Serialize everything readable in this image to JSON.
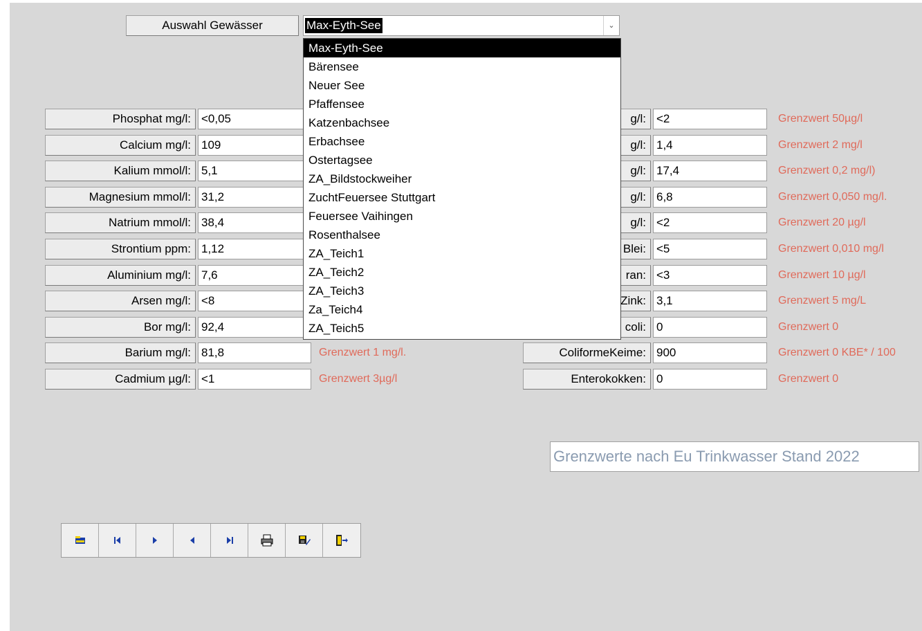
{
  "selector": {
    "label": "Auswahl Gewässer",
    "value": "Max-Eyth-See",
    "options": [
      "Max-Eyth-See",
      "Bärensee",
      "Neuer See",
      "Pfaffensee",
      "Katzenbachsee",
      "Erbachsee",
      "Ostertagsee",
      "ZA_Bildstockweiher",
      "ZuchtFeuersee Stuttgart",
      "Feuersee Vaihingen",
      "Rosenthalsee",
      "ZA_Teich1",
      "ZA_Teich2",
      "ZA_Teich3",
      "Za_Teich4",
      "ZA_Teich5"
    ]
  },
  "left": [
    {
      "label": "Phosphat mg/l:",
      "value": "<0,05"
    },
    {
      "label": "Calcium mg/l:",
      "value": "109"
    },
    {
      "label": "Kalium mmol/l:",
      "value": "5,1"
    },
    {
      "label": "Magnesium mmol/l:",
      "value": "31,2"
    },
    {
      "label": "Natrium mmol/l:",
      "value": "38,4"
    },
    {
      "label": "Strontium ppm:",
      "value": "1,12"
    },
    {
      "label": "Aluminium mg/l:",
      "value": "7,6"
    },
    {
      "label": "Arsen mg/l:",
      "value": "<8"
    },
    {
      "label": "Bor mg/l:",
      "value": "92,4"
    },
    {
      "label": "Barium mg/l:",
      "value": "81,8",
      "limit": "Grenzwert 1 mg/l."
    },
    {
      "label": "Cadmium µg/l:",
      "value": "<1",
      "limit": "Grenzwert 3µg/l"
    }
  ],
  "right": [
    {
      "label": "g/l:",
      "value": "<2",
      "limit": "Grenzwert 50µg/l"
    },
    {
      "label": "g/l:",
      "value": "1,4",
      "limit": "Grenzwert 2 mg/l"
    },
    {
      "label": "g/l:",
      "value": "17,4",
      "limit": "Grenzwert 0,2 mg/l)"
    },
    {
      "label": "g/l:",
      "value": "6,8",
      "limit": "Grenzwert 0,050 mg/l."
    },
    {
      "label": "g/l:",
      "value": "<2",
      "limit": "Grenzwert  20 µg/l"
    },
    {
      "label": "Blei:",
      "value": "<5",
      "limit": "Grenzwert 0,010 mg/l"
    },
    {
      "label": "ran:",
      "value": "<3",
      "limit": "Grenzwert 10 µg/l"
    },
    {
      "label": "Zink:",
      "value": "3,1",
      "limit": "Grenzwert 5 mg/L"
    },
    {
      "label": "coli:",
      "value": "0",
      "limit": "Grenzwert  0"
    },
    {
      "label": "ColiformeKeime:",
      "value": "900",
      "limit": "Grenzwert  0 KBE* / 100"
    },
    {
      "label": "Enterokokken:",
      "value": "0",
      "limit": "Grenzwert 0"
    }
  ],
  "note": "Grenzwerte nach Eu Trinkwasser Stand 2022",
  "nav": [
    {
      "name": "new-record-icon"
    },
    {
      "name": "first-record-icon"
    },
    {
      "name": "next-record-icon"
    },
    {
      "name": "previous-record-icon"
    },
    {
      "name": "last-record-icon"
    },
    {
      "name": "print-icon"
    },
    {
      "name": "save-icon"
    },
    {
      "name": "exit-icon"
    }
  ],
  "colors": {
    "limit_text": "#e06a5a",
    "form_bg": "#d8d8d8",
    "note_text": "#8a9bb0"
  }
}
